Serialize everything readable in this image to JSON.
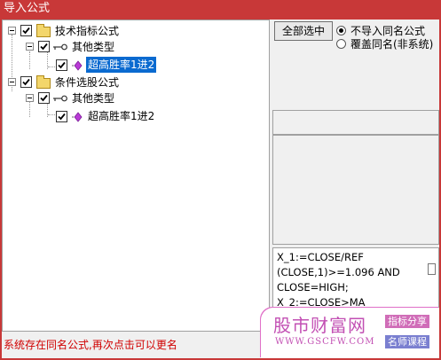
{
  "window": {
    "title": "导入公式"
  },
  "tree": {
    "nodes": [
      {
        "label": "技术指标公式",
        "checked": true,
        "icon": "folder-icon"
      },
      {
        "label": "其他类型",
        "checked": true,
        "icon": "key-icon"
      },
      {
        "label": "超高胜率1进2",
        "checked": true,
        "icon": "diamond-icon",
        "selected": true
      },
      {
        "label": "条件选股公式",
        "checked": true,
        "icon": "folder-icon"
      },
      {
        "label": "其他类型",
        "checked": true,
        "icon": "key-icon"
      },
      {
        "label": "超高胜率1进2",
        "checked": true,
        "icon": "diamond-icon",
        "selected": false
      }
    ]
  },
  "controls": {
    "select_all_label": "全部选中",
    "radio_options": [
      {
        "label": "不导入同名公式",
        "selected": true
      },
      {
        "label": "覆盖同名(非系统)",
        "selected": false
      }
    ]
  },
  "formula_preview": "X_1:=CLOSE/REF\n(CLOSE,1)>=1.096 AND\nCLOSE=HIGH;\nX_2:=CLOSE>MA",
  "status_text": "系统存在同名公式,再次点击可以更名",
  "watermark": {
    "site_name": "股市财富网",
    "url": "WWW.GSCFW.COM",
    "tag1": "指标分享",
    "tag2": "名师课程"
  },
  "colors": {
    "titlebar": "#c83838",
    "selection": "#0a6ad0",
    "status_text": "#d00000"
  }
}
